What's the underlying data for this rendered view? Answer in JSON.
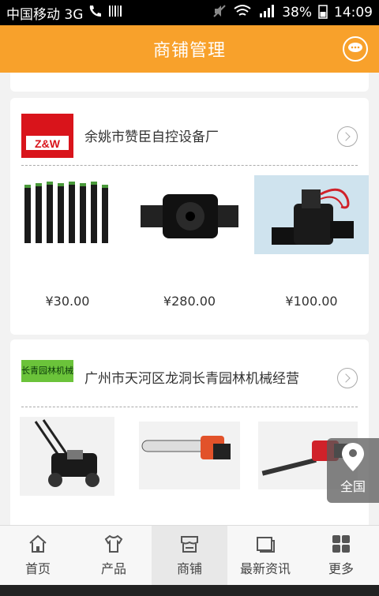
{
  "statusbar": {
    "carrier": "中国移动 3G",
    "battery": "38%",
    "time": "14:09"
  },
  "header": {
    "title": "商铺管理"
  },
  "shops": [
    {
      "name": "余姚市赞臣自控设备厂",
      "logo_text": "Z&W",
      "prices": [
        "¥30.00",
        "¥280.00",
        "¥100.00"
      ]
    },
    {
      "name": "广州市天河区龙洞长青园林机械经营",
      "logo_text": "长青园林机械"
    }
  ],
  "floating": {
    "label": "全国"
  },
  "nav": [
    {
      "label": "首页",
      "icon": "home-icon"
    },
    {
      "label": "产品",
      "icon": "shirt-icon"
    },
    {
      "label": "商铺",
      "icon": "store-icon"
    },
    {
      "label": "最新资讯",
      "icon": "news-icon"
    },
    {
      "label": "更多",
      "icon": "grid-icon"
    }
  ],
  "colors": {
    "accent": "#f8a12b"
  }
}
